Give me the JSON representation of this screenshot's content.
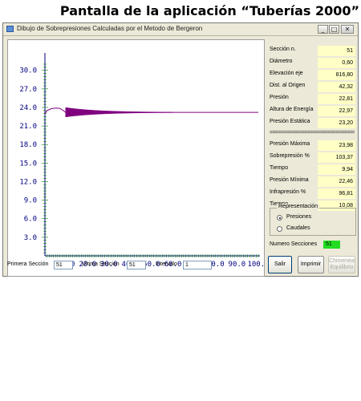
{
  "caption": "Pantalla de la aplicación “Tuberías 2000”",
  "window": {
    "title": "Dibujo de Sobrepresiones Calculadas por el Metodo de Bergeron",
    "btn_min": "_",
    "btn_max": "□",
    "btn_close": "✕"
  },
  "chart_data": {
    "type": "line",
    "x_ticks": [
      "10.0",
      "20.0",
      "30.0",
      "40.0",
      "50.0",
      "60.0",
      "70.0",
      "80.0",
      "90.0",
      "100.0"
    ],
    "y_ticks": [
      "3.0",
      "6.0",
      "9.0",
      "12.0",
      "15.0",
      "18.0",
      "21.0",
      "24.0",
      "27.0",
      "30.0"
    ],
    "xlim": [
      0,
      100
    ],
    "ylim": [
      0,
      31
    ],
    "series_color": "#800080",
    "series": [
      {
        "x": [
          0,
          1,
          3,
          5,
          7,
          9,
          9.7,
          10,
          60,
          100
        ],
        "y": [
          23.0,
          23.5,
          23.8,
          23.9,
          23.85,
          23.4,
          23.2,
          23.2,
          23.2,
          23.2
        ]
      }
    ],
    "oscillation": {
      "x_start": 9.7,
      "x_end": 60,
      "pressure_max": 23.98,
      "pressure_min": 22.46
    }
  },
  "panel": {
    "rows": [
      {
        "label": "Sección n.",
        "value": "51"
      },
      {
        "label": "Diámetro",
        "value": "0,60"
      },
      {
        "label": "Elevación eje",
        "value": "816,80"
      },
      {
        "label": "Dist. al Origen",
        "value": "42,32"
      },
      {
        "label": "Presión",
        "value": "22,81"
      },
      {
        "label": "Altura de Energía",
        "value": "22,97"
      },
      {
        "label": "Presión Estática",
        "value": "23,20"
      }
    ],
    "separator": "================================",
    "rows2": [
      {
        "label": "Presión Máxima",
        "value": "23,98"
      },
      {
        "label": "Sobrepresión %",
        "value": "103,37"
      },
      {
        "label": "Tiempo",
        "value": "9,94"
      },
      {
        "label": "Presión Mínima",
        "value": "22,46"
      },
      {
        "label": "Infrapresión %",
        "value": "96,81"
      },
      {
        "label": "Tiempo",
        "value": "10,08"
      }
    ]
  },
  "representation": {
    "title": "Representación",
    "options": [
      "Presiones",
      "Caudales"
    ],
    "selected": "Presiones"
  },
  "num_sections": {
    "label": "Numero Secciones",
    "value": "51"
  },
  "bottom": {
    "primera_label": "Primera Sección",
    "primera_value": "51",
    "ultima_label": "Ultima Sección",
    "ultima_value": "51",
    "intervalo_label": "Intervalo",
    "intervalo_value": "1"
  },
  "buttons": {
    "salir": "Salir",
    "imprimir": "Imprimir",
    "chimenea": "Chimenea Equilibrio"
  },
  "colors": {
    "field_bg": "#ffffc6",
    "window_bg": "#ece9d8",
    "axis": "#000080",
    "tick": "#008000",
    "series": "#800080"
  }
}
